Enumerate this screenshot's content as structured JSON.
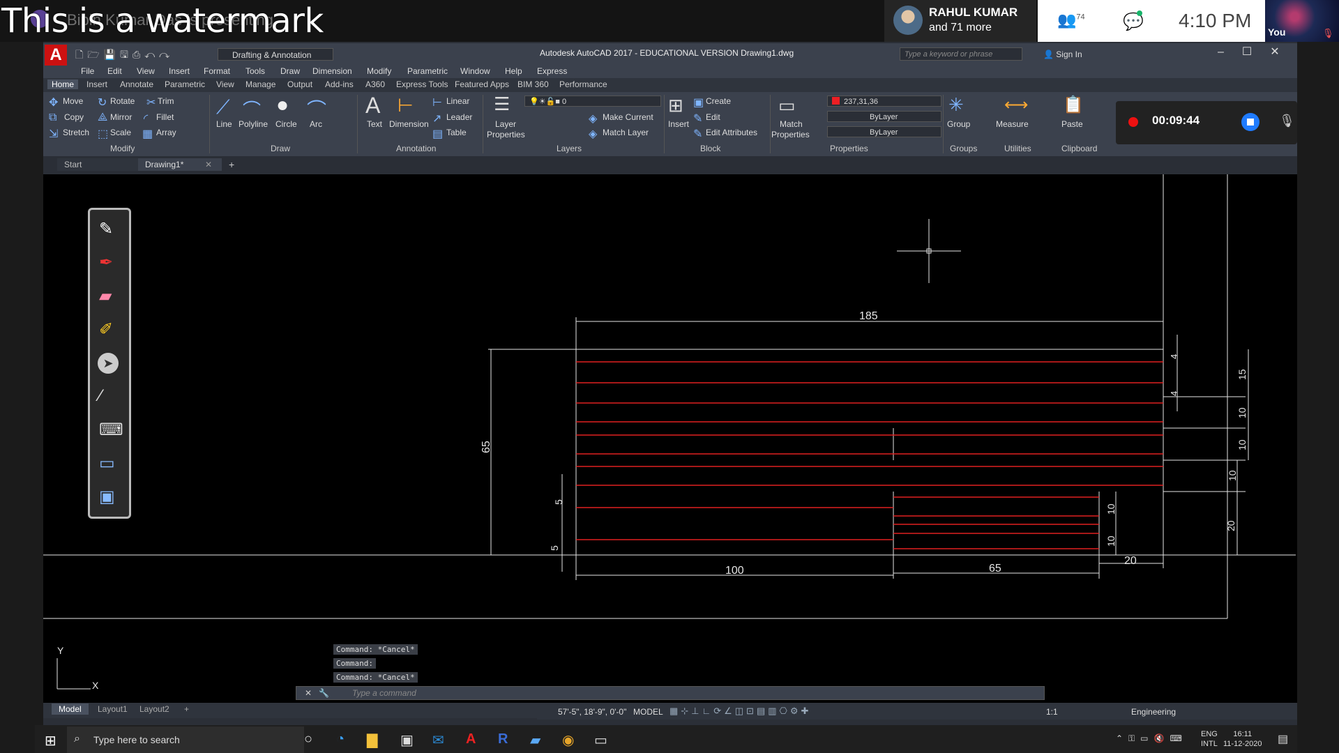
{
  "meeting": {
    "watermark": "This is a watermark",
    "presenter": "Bipin Kumar Das is presenting",
    "participant_name": "RAHUL KUMAR",
    "participant_more": "and 71 more",
    "people_count": "74",
    "clock": "4:10 PM",
    "you_label": "You"
  },
  "acad": {
    "logo": "A",
    "workspace": "Drafting & Annotation",
    "title": "Autodesk AutoCAD 2017 - EDUCATIONAL VERSION     Drawing1.dwg",
    "search_placeholder": "Type a keyword or phrase",
    "sign_in": "Sign In",
    "menus": [
      "File",
      "Edit",
      "View",
      "Insert",
      "Format",
      "Tools",
      "Draw",
      "Dimension",
      "Modify",
      "Parametric",
      "Window",
      "Help",
      "Express"
    ],
    "ribbon_tabs": [
      "Home",
      "Insert",
      "Annotate",
      "Parametric",
      "View",
      "Manage",
      "Output",
      "Add-ins",
      "A360",
      "Express Tools",
      "Featured Apps",
      "BIM 360",
      "Performance"
    ],
    "modify": {
      "move": "Move",
      "rotate": "Rotate",
      "trim": "Trim",
      "copy": "Copy",
      "mirror": "Mirror",
      "fillet": "Fillet",
      "stretch": "Stretch",
      "scale": "Scale",
      "array": "Array",
      "title": "Modify"
    },
    "draw": {
      "line": "Line",
      "polyline": "Polyline",
      "circle": "Circle",
      "arc": "Arc",
      "title": "Draw"
    },
    "annotation": {
      "text": "Text",
      "dimension": "Dimension",
      "linear": "Linear",
      "leader": "Leader",
      "table": "Table",
      "title": "Annotation"
    },
    "layers": {
      "layer_properties_1": "Layer",
      "layer_properties_2": "Properties",
      "current_layer": "0",
      "make_current": "Make Current",
      "match_layer": "Match Layer",
      "title": "Layers"
    },
    "block": {
      "insert": "Insert",
      "create": "Create",
      "edit": "Edit",
      "edit_attributes": "Edit Attributes",
      "title": "Block"
    },
    "properties": {
      "match_1": "Match",
      "match_2": "Properties",
      "color": "237,31,36",
      "linetype": "ByLayer",
      "lineweight": "ByLayer",
      "title": "Properties"
    },
    "groups": {
      "group": "Group",
      "title": "Groups"
    },
    "utilities": {
      "measure": "Measure",
      "title": "Utilities"
    },
    "clipboard": {
      "paste": "Paste",
      "title": "Clipboard"
    },
    "doc_tabs": [
      "Start",
      "Drawing1*"
    ],
    "recorder_time": "00:09:44",
    "command_history": [
      "Command: *Cancel*",
      "Command:",
      "Command: *Cancel*"
    ],
    "command_placeholder": "Type a command",
    "layout_tabs": [
      "Model",
      "Layout1",
      "Layout2"
    ],
    "coords": "57'-5\", 18'-9\", 0'-0\"",
    "model": "MODEL",
    "units": "Engineering",
    "scale": "1:1"
  },
  "drawing": {
    "dimensions": [
      "185",
      "65",
      "4",
      "4",
      "15",
      "10",
      "10",
      "10",
      "20",
      "5",
      "5",
      "10",
      "10",
      "100",
      "65",
      "20"
    ],
    "ucs_x": "X",
    "ucs_y": "Y",
    "line_color": "#e02020"
  },
  "taskbar": {
    "search": "Type here to search",
    "lang_1": "ENG",
    "lang_2": "INTL",
    "time": "16:11",
    "date": "11-12-2020"
  }
}
